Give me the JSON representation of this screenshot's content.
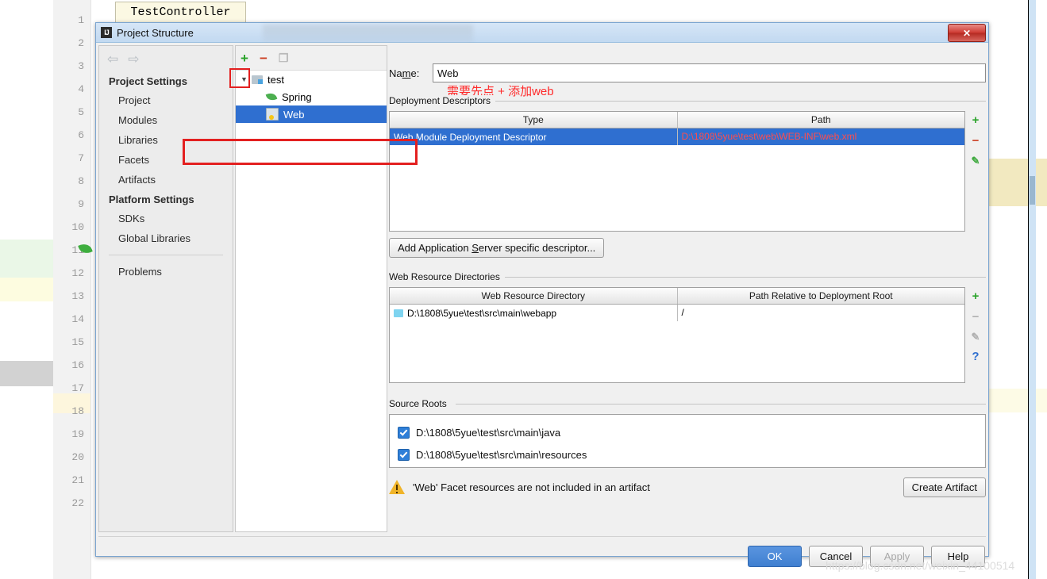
{
  "editor": {
    "tab_label": "TestController",
    "line_numbers": [
      "1",
      "2",
      "3",
      "4",
      "5",
      "6",
      "7",
      "8",
      "9",
      "10",
      "11",
      "12",
      "13",
      "14",
      "15",
      "16",
      "17",
      "18",
      "19",
      "20",
      "21",
      "22"
    ],
    "highlighted_line": "18",
    "watermark": "https://blog.csdn.net/weixin_44100514"
  },
  "dialog": {
    "title": "Project Structure",
    "title_icon": "intellij-idea-icon",
    "close_label": "✕",
    "annotation": "需要先点 + 添加web"
  },
  "nav": {
    "back_icon": "arrow-left-icon",
    "forward_icon": "arrow-right-icon"
  },
  "sidebar": {
    "groups": [
      {
        "label": "Project Settings",
        "items": [
          {
            "label": "Project"
          },
          {
            "label": "Modules"
          },
          {
            "label": "Libraries"
          },
          {
            "label": "Facets"
          },
          {
            "label": "Artifacts"
          }
        ]
      },
      {
        "label": "Platform Settings",
        "items": [
          {
            "label": "SDKs"
          },
          {
            "label": "Global Libraries"
          }
        ]
      }
    ],
    "problems_label": "Problems"
  },
  "tree_toolbar": {
    "add_label": "+",
    "remove_label": "−",
    "copy_label": "❐"
  },
  "tree": {
    "nodes": [
      {
        "label": "test",
        "icon": "folder-module-icon",
        "level": 1,
        "expanded": true,
        "selected": false
      },
      {
        "label": "Spring",
        "icon": "spring-leaf-icon",
        "level": 2,
        "selected": false
      },
      {
        "label": "Web",
        "icon": "web-facet-icon",
        "level": 2,
        "selected": true
      }
    ]
  },
  "form": {
    "name_label_prefix": "Na",
    "name_label_accel": "m",
    "name_label_suffix": "e:",
    "name_value": "Web"
  },
  "deployment_descriptors": {
    "group_label": "Deployment Descriptors",
    "columns": [
      "Type",
      "Path"
    ],
    "rows": [
      {
        "type": "Web Module Deployment Descriptor",
        "path": "D:\\1808\\5yue\\test\\web\\WEB-INF\\web.xml",
        "selected": true
      }
    ],
    "side_buttons": [
      {
        "name": "add-descriptor-icon",
        "label": "+",
        "style": "green"
      },
      {
        "name": "remove-descriptor-icon",
        "label": "−",
        "style": "red"
      },
      {
        "name": "edit-descriptor-icon",
        "label": "✎",
        "style": "pencil"
      }
    ],
    "add_button": {
      "prefix": "Add Application ",
      "accel": "S",
      "suffix": "erver specific descriptor..."
    }
  },
  "web_resource_directories": {
    "group_label": "Web Resource Directories",
    "columns": [
      "Web Resource Directory",
      "Path Relative to Deployment Root"
    ],
    "rows": [
      {
        "directory": "D:\\1808\\5yue\\test\\src\\main\\webapp",
        "relative_path": "/"
      }
    ],
    "side_buttons": [
      {
        "name": "add-resource-dir-icon",
        "label": "+",
        "style": "green"
      },
      {
        "name": "remove-resource-dir-icon",
        "label": "−",
        "style": "gray"
      },
      {
        "name": "edit-resource-dir-icon",
        "label": "✎",
        "style": "pencil-gray"
      },
      {
        "name": "help-resource-dir-icon",
        "label": "?",
        "style": "qmark"
      }
    ]
  },
  "source_roots": {
    "group_label": "Source Roots",
    "items": [
      {
        "label": "D:\\1808\\5yue\\test\\src\\main\\java",
        "checked": true
      },
      {
        "label": "D:\\1808\\5yue\\test\\src\\main\\resources",
        "checked": true
      }
    ]
  },
  "warning": {
    "icon": "warning-triangle-icon",
    "text": "'Web' Facet resources are not included in an artifact",
    "action_label": "Create Artifact"
  },
  "footer": {
    "ok_label": "OK",
    "cancel_label": "Cancel",
    "apply_label": "Apply",
    "help_label": "Help"
  },
  "colors": {
    "accent_blue": "#2f6fd0",
    "annotation_red": "#ff2a2a",
    "path_red": "#e01b1b",
    "add_green": "#2aa32a",
    "remove_red": "#cc4125",
    "warning_amber": "#f0b429"
  }
}
